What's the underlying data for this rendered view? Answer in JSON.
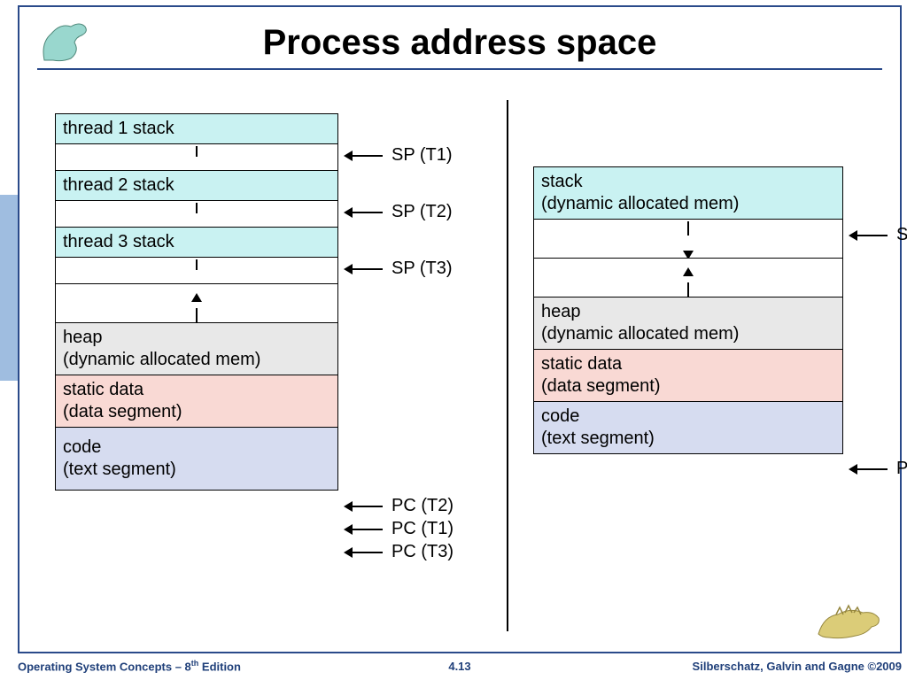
{
  "title": "Process address space",
  "left": {
    "segments": {
      "t1": "thread 1 stack",
      "t2": "thread 2 stack",
      "t3": "thread 3 stack",
      "heap1": "heap",
      "heap2": "(dynamic allocated mem)",
      "static1": "static data",
      "static2": "(data segment)",
      "code1": "code",
      "code2": "(text segment)"
    },
    "pointers": {
      "sp1": "SP (T1)",
      "sp2": "SP (T2)",
      "sp3": "SP (T3)",
      "pc2": "PC (T2)",
      "pc1": "PC (T1)",
      "pc3": "PC (T3)"
    }
  },
  "right": {
    "segments": {
      "stack1": "stack",
      "stack2": "(dynamic allocated mem)",
      "heap1": "heap",
      "heap2": "(dynamic allocated mem)",
      "static1": "static data",
      "static2": "(data segment)",
      "code1": "code",
      "code2": "(text segment)"
    },
    "pointers": {
      "sp": "SP",
      "pc": "PC"
    }
  },
  "footer": {
    "left1": "Operating System Concepts – 8",
    "left_sup": "th",
    "left2": " Edition",
    "mid": "4.13",
    "right": "Silberschatz, Galvin and Gagne ©2009"
  }
}
